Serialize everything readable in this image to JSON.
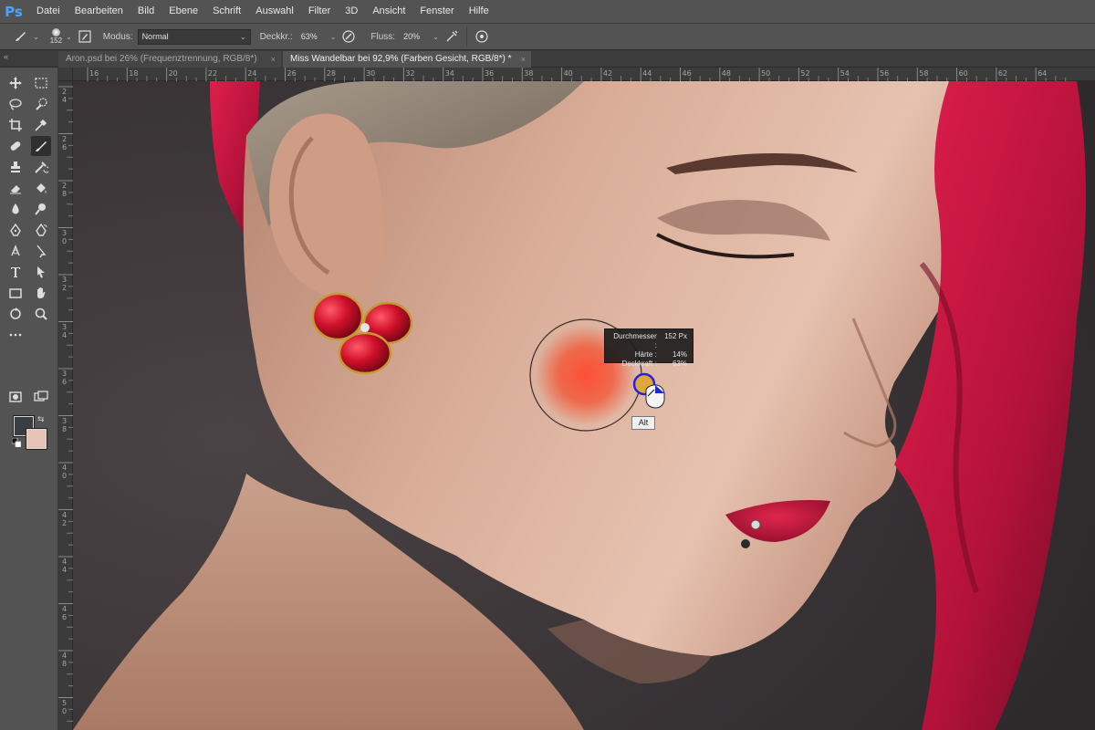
{
  "app": {
    "logo": "Ps",
    "menu": [
      "Datei",
      "Bearbeiten",
      "Bild",
      "Ebene",
      "Schrift",
      "Auswahl",
      "Filter",
      "3D",
      "Ansicht",
      "Fenster",
      "Hilfe"
    ]
  },
  "options": {
    "brush_size": "152",
    "modus_label": "Modus:",
    "modus_value": "Normal",
    "deckkraft_label": "Deckkr.:",
    "deckkraft_value": "63%",
    "fluss_label": "Fluss:",
    "fluss_value": "20%"
  },
  "tabs": [
    {
      "label": "Aron.psd bei 26% (Frequenztrennung, RGB/8*)",
      "close": "×"
    },
    {
      "label": "Miss Wandelbar bei 92,9% (Farben Gesicht, RGB/8*) *",
      "close": "×"
    }
  ],
  "ruler_h": [
    "16",
    "18",
    "20",
    "22",
    "24",
    "26",
    "28",
    "30",
    "32",
    "34",
    "36",
    "38",
    "40",
    "42",
    "44",
    "46",
    "48",
    "50",
    "52",
    "54",
    "56",
    "58",
    "60",
    "62",
    "64"
  ],
  "ruler_v": [
    "2",
    "2",
    "2",
    "2",
    "2",
    "2",
    "2",
    "2",
    "2",
    "2",
    "2",
    "2",
    "2",
    "2",
    "2",
    "2",
    "2",
    "2",
    "2",
    "2",
    "2",
    "2",
    "2",
    "2",
    "2",
    "2",
    "2",
    "2"
  ],
  "ruler_v_text": [
    "2",
    "4",
    "2",
    "6",
    "2",
    "8",
    "3",
    "0",
    "3",
    "2",
    "3",
    "4",
    "3",
    "6",
    "3",
    "8",
    "4",
    "0",
    "4",
    "2",
    "4",
    "4",
    "4",
    "6",
    "4",
    "8",
    "5",
    "0"
  ],
  "hud": {
    "rows": [
      {
        "label": "Durchmesser :",
        "value": "152 Px"
      },
      {
        "label": "Härte :",
        "value": "14%"
      },
      {
        "label": "Deckkraft :",
        "value": "63%"
      }
    ]
  },
  "tooltip": "Alt",
  "colors": {
    "foreground": "#3a3d44",
    "background": "#e8c4b8",
    "accent": "#4aa3ff"
  }
}
